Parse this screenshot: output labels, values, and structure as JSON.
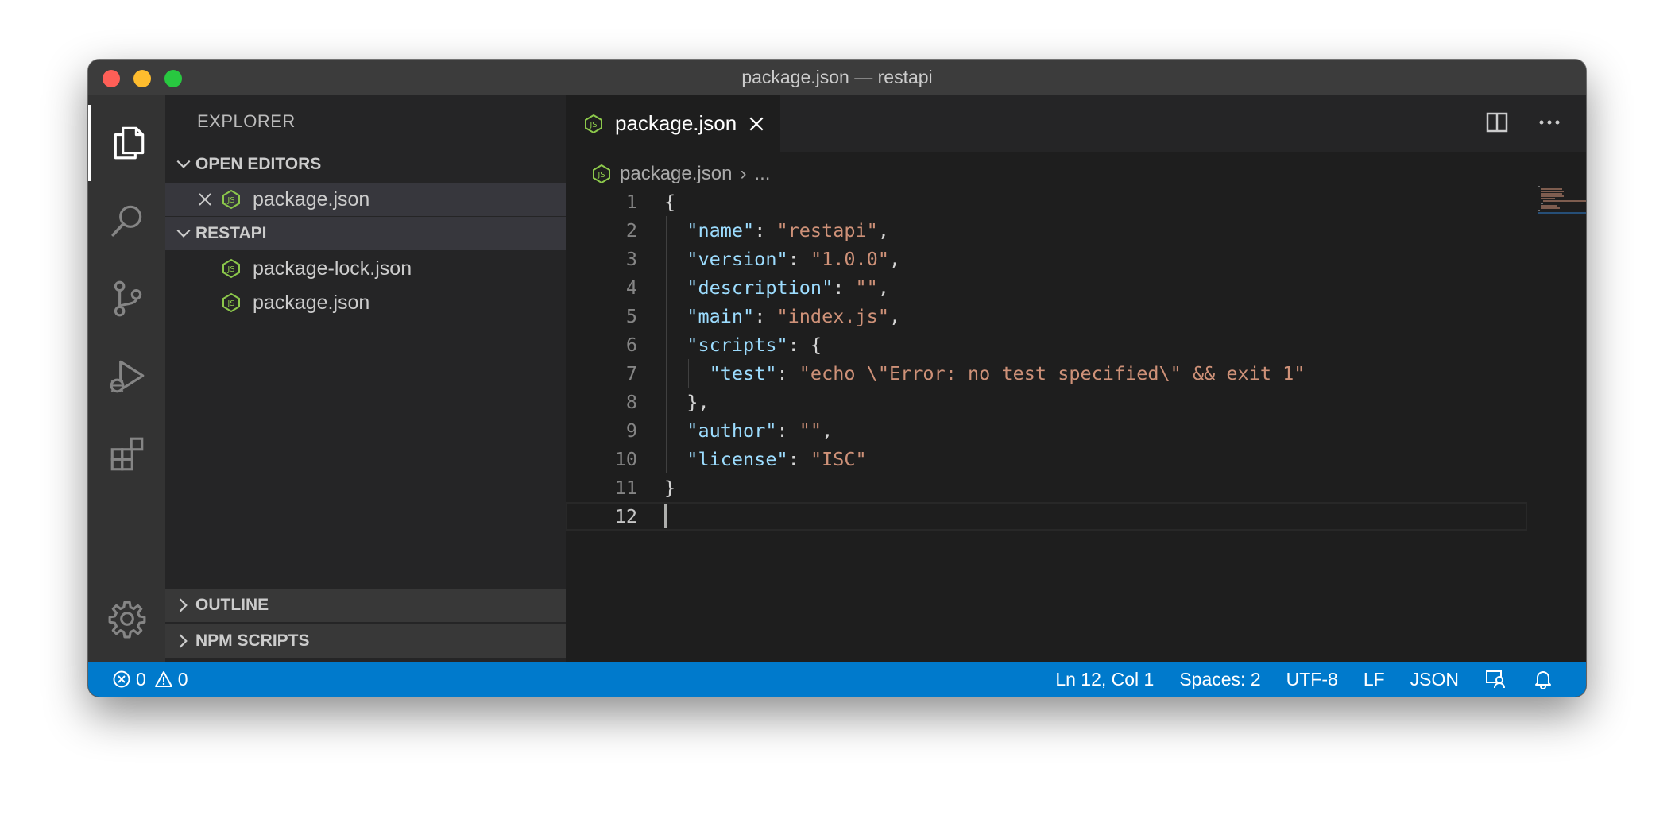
{
  "window": {
    "title": "package.json — restapi"
  },
  "activity_bar": {
    "items": [
      "explorer-icon",
      "search-icon",
      "source-control-icon",
      "run-debug-icon",
      "extensions-icon"
    ],
    "bottom": "gear-icon"
  },
  "sidebar": {
    "title": "EXPLORER",
    "open_editors": {
      "header": "OPEN EDITORS",
      "files": [
        {
          "name": "package.json",
          "icon": "nodejs-icon"
        }
      ]
    },
    "project": {
      "header": "RESTAPI",
      "files": [
        {
          "name": "package-lock.json",
          "icon": "nodejs-icon"
        },
        {
          "name": "package.json",
          "icon": "nodejs-icon"
        }
      ]
    },
    "outline_header": "OUTLINE",
    "npm_scripts_header": "NPM SCRIPTS"
  },
  "editor": {
    "tab": {
      "label": "package.json",
      "icon": "nodejs-icon"
    },
    "breadcrumb": {
      "file": "package.json",
      "separator": "›",
      "rest": "..."
    },
    "lines": [
      "{",
      "  \"name\": \"restapi\",",
      "  \"version\": \"1.0.0\",",
      "  \"description\": \"\",",
      "  \"main\": \"index.js\",",
      "  \"scripts\": {",
      "    \"test\": \"echo \\\"Error: no test specified\\\" && exit 1\"",
      "  },",
      "  \"author\": \"\",",
      "  \"license\": \"ISC\"",
      "}",
      ""
    ],
    "line_numbers": [
      "1",
      "2",
      "3",
      "4",
      "5",
      "6",
      "7",
      "8",
      "9",
      "10",
      "11",
      "12"
    ],
    "current_line": 12
  },
  "status_bar": {
    "errors": "0",
    "warnings": "0",
    "position": "Ln 12, Col 1",
    "spaces": "Spaces: 2",
    "encoding": "UTF-8",
    "eol": "LF",
    "language": "JSON"
  },
  "colors": {
    "accent": "#007acc",
    "json_key": "#9cdcfe",
    "json_string": "#ce9178",
    "nodejs_icon": "#8cc84b"
  }
}
